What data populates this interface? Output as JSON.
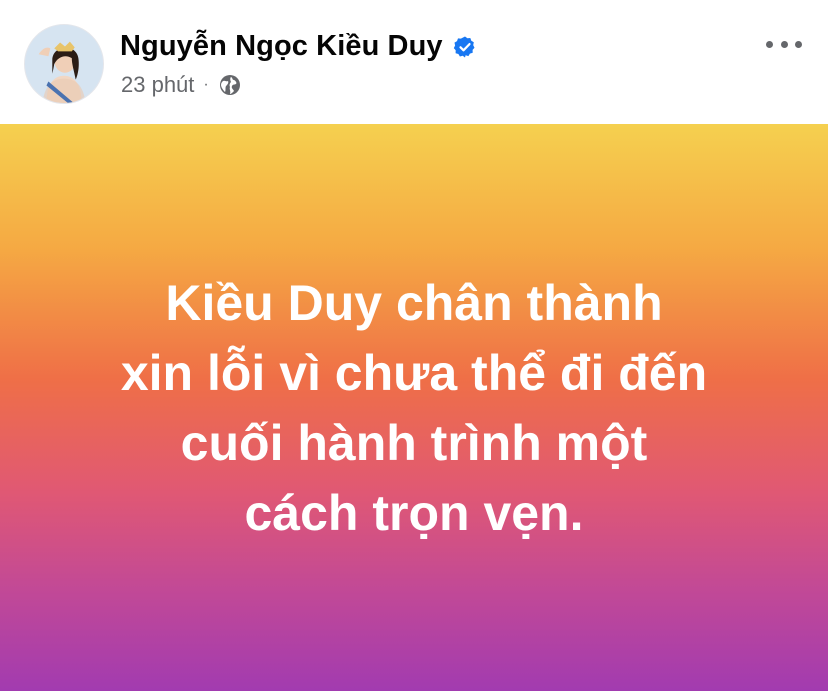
{
  "post": {
    "author_name": "Nguyễn Ngọc Kiều Duy",
    "verified_icon": "verified-badge-icon",
    "timestamp": "23 phút",
    "separator": "·",
    "audience_icon": "globe-icon",
    "more_icon": "more-options-icon",
    "status_lines": [
      "Kiều Duy chân thành",
      "xin lỗi vì chưa thể đi đến",
      "cuối hành trình một",
      "cách trọn vẹn."
    ]
  },
  "colors": {
    "verified_blue": "#1877f2",
    "meta_gray": "#65676b",
    "gradient_top": "#f5d04f",
    "gradient_bottom": "#a23bb0"
  }
}
